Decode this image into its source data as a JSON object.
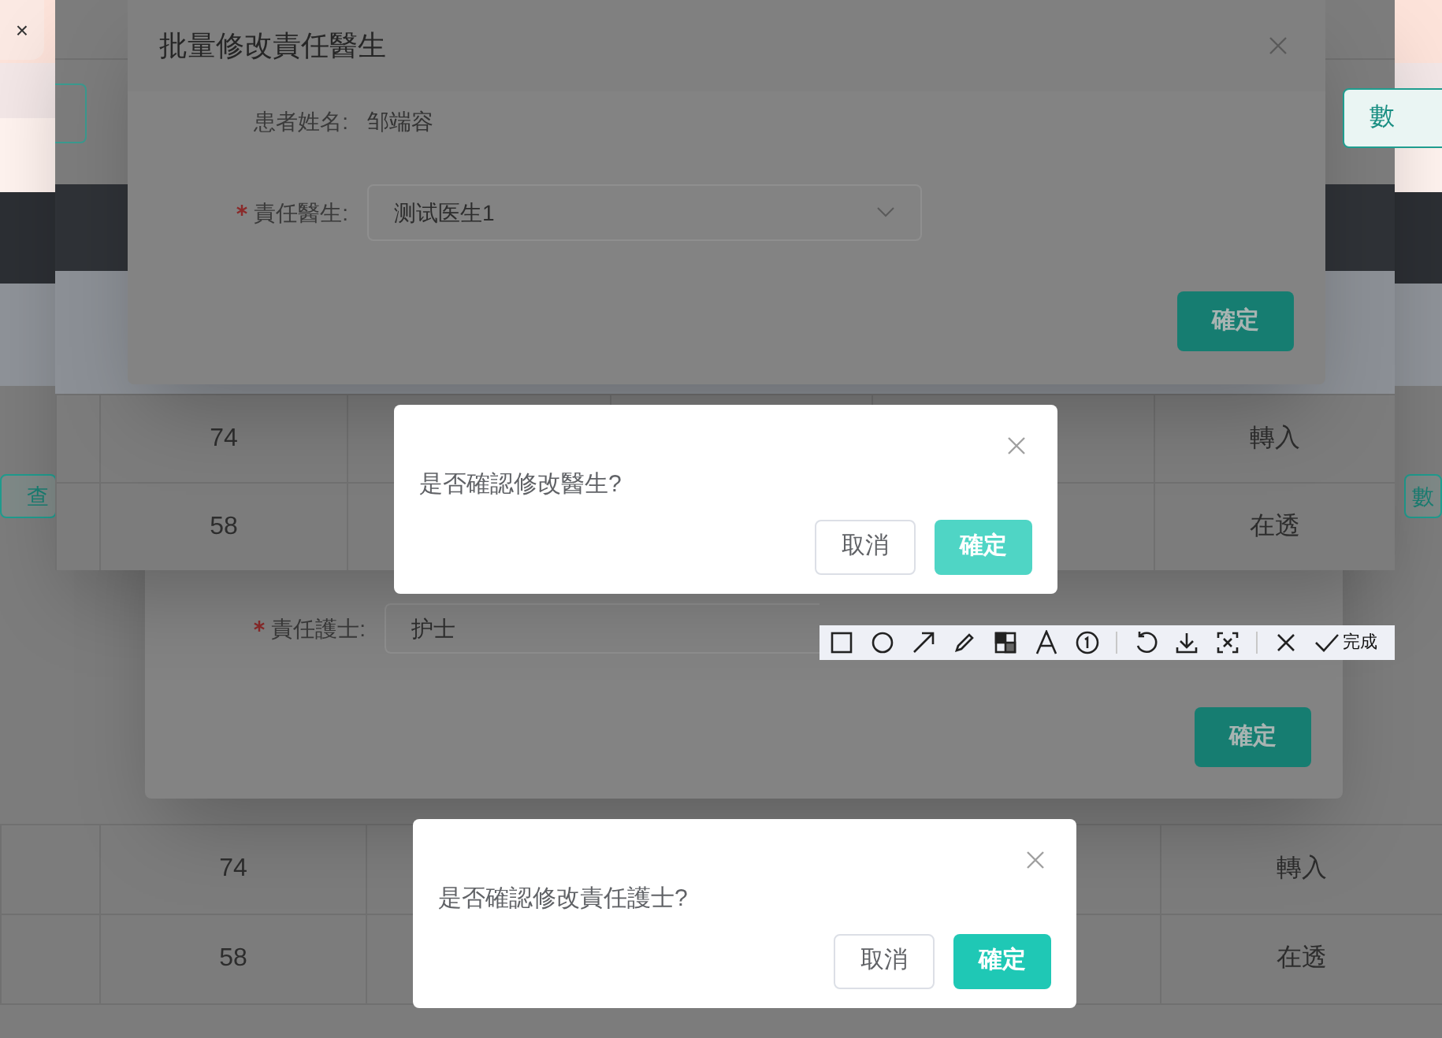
{
  "page": {
    "close_tab": "×",
    "left_button": "查",
    "right_buttons": [
      "數",
      "數"
    ]
  },
  "lower_table": {
    "rows": [
      {
        "cells": [
          "74",
          "轉入"
        ]
      },
      {
        "cells": [
          "58",
          "在透"
        ]
      }
    ]
  },
  "nurse_dialog": {
    "field_label": "責任護士:",
    "required": true,
    "field_value": "护士",
    "confirm": "確定"
  },
  "upper_window": {
    "rows": [
      {
        "cells": [
          "74",
          "轉入"
        ]
      },
      {
        "cells": [
          "58",
          "在透"
        ]
      }
    ]
  },
  "doctor_dialog": {
    "title": "批量修改責任醫生",
    "patient_label": "患者姓名:",
    "patient_name": "邹端容",
    "field_label": "責任醫生:",
    "required": true,
    "field_value": "测试医生1",
    "confirm": "確定"
  },
  "doctor_confirm": {
    "message": "是否確認修改醫生?",
    "cancel": "取消",
    "ok": "確定"
  },
  "toolbar": {
    "done": "完成"
  },
  "nurse_confirm": {
    "message": "是否確認修改責任護士?",
    "cancel": "取消",
    "ok": "確定"
  }
}
